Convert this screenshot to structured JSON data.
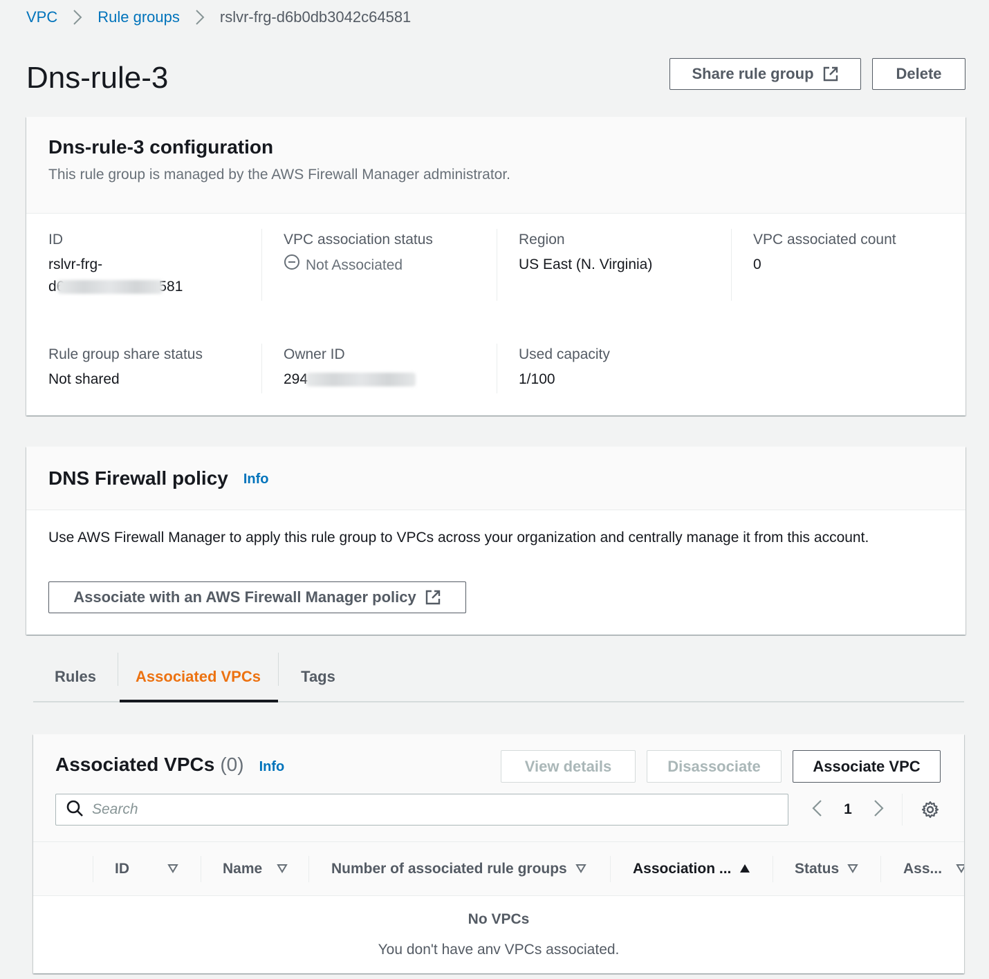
{
  "breadcrumb": {
    "items": [
      "VPC",
      "Rule groups"
    ],
    "current": "rslvr-frg-d6b0db3042c64581"
  },
  "header": {
    "title": "Dns-rule-3",
    "share_button": "Share rule group",
    "delete_button": "Delete"
  },
  "config": {
    "title": "Dns-rule-3 configuration",
    "description": "This rule group is managed by the AWS Firewall Manager administrator.",
    "id_label": "ID",
    "id_value_line1": "rslvr-frg-",
    "id_value_prefix": "d6",
    "id_value_suffix": "581",
    "vpc_status_label": "VPC association status",
    "vpc_status_value": "Not Associated",
    "region_label": "Region",
    "region_value": "US East (N. Virginia)",
    "vpc_count_label": "VPC associated count",
    "vpc_count_value": "0",
    "share_status_label": "Rule group share status",
    "share_status_value": "Not shared",
    "owner_label": "Owner ID",
    "owner_value_prefix": "294",
    "capacity_label": "Used capacity",
    "capacity_value": "1/100"
  },
  "policy": {
    "title": "DNS Firewall policy",
    "info": "Info",
    "body": "Use AWS Firewall Manager to apply this rule group to VPCs across your organization and centrally manage it from this account.",
    "button": "Associate with an AWS Firewall Manager policy"
  },
  "tabs": [
    {
      "label": "Rules",
      "active": false
    },
    {
      "label": "Associated VPCs",
      "active": true
    },
    {
      "label": "Tags",
      "active": false
    }
  ],
  "vpcs": {
    "title": "Associated VPCs",
    "count": "(0)",
    "info": "Info",
    "view_details": "View details",
    "disassociate": "Disassociate",
    "associate": "Associate VPC",
    "search_placeholder": "Search",
    "page": "1",
    "columns": [
      "ID",
      "Name",
      "Number of associated rule groups",
      "Association ...",
      "Status",
      "Ass..."
    ],
    "sorted_column": "Association ...",
    "empty_title": "No VPCs",
    "empty_desc": "You don't have anv VPCs associated."
  },
  "colors": {
    "link": "#0073bb",
    "active_tab": "#ec7211",
    "text": "#16191f",
    "muted": "#545b64"
  }
}
